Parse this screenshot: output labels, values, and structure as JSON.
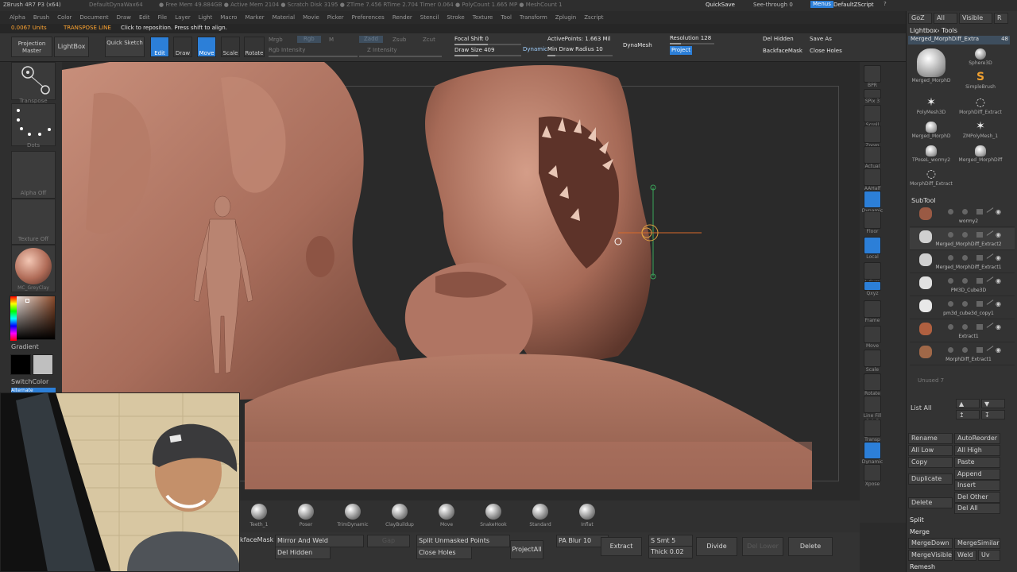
{
  "titlebar": {
    "app": "ZBrush 4R7 P3 (x64)",
    "doc": "DefaultDynaWax64",
    "stats": "● Free Mem 49.884GB ● Active Mem 2104 ● Scratch Disk 3195 ● ZTime 7.456 RTime 2.704 Timer 0.064 ● PolyCount 1.665 MP ● MeshCount 1",
    "quicksave": "QuickSave",
    "seethrough": "See-through",
    "seethrough_val": "0",
    "menus": "Menus",
    "script": "DefaultZScript"
  },
  "menubar": [
    "Alpha",
    "Brush",
    "Color",
    "Document",
    "Draw",
    "Edit",
    "File",
    "Layer",
    "Light",
    "Macro",
    "Marker",
    "Material",
    "Movie",
    "Picker",
    "Preferences",
    "Render",
    "Stencil",
    "Stroke",
    "Texture",
    "Tool",
    "Transform",
    "Zplugin",
    "Zscript"
  ],
  "notebar": {
    "units": "0.0067 Units",
    "mode": "TRANSPOSE LINE",
    "hint": "Click to reposition. Press shift to align."
  },
  "toolbar": {
    "projection_master": "Projection Master",
    "lightbox": "LightBox",
    "quick_sketch": "Quick Sketch",
    "edit": "Edit",
    "draw": "Draw",
    "move": "Move",
    "scale": "Scale",
    "rotate": "Rotate",
    "mrgb": "Mrgb",
    "rgb": "Rgb",
    "m": "M",
    "rgb_intensity": "Rgb Intensity",
    "zadd": "Zadd",
    "zsub": "Zsub",
    "zcut": "Zcut",
    "z_intensity": "Z Intensity",
    "focal_shift": "Focal Shift 0",
    "draw_size": "Draw Size 409",
    "dynamic": "Dynamic",
    "active_points": "ActivePoints: 1.663 Mil",
    "min_draw_radius": "Min Draw Radius 10",
    "dynamesh": "DynaMesh",
    "resolution": "Resolution 128",
    "project": "Project",
    "del_hidden": "Del Hidden",
    "save_as": "Save As",
    "backface_mask": "BackfaceMask",
    "close_holes": "Close Holes"
  },
  "leftshelf": {
    "transpose": "Transpose",
    "dots": "Dots",
    "alpha": "Alpha Off",
    "texture": "Texture Off",
    "material": "MC_GreyClay",
    "gradient": "Gradient",
    "switchcolor": "SwitchColor",
    "alternate": "Alternate"
  },
  "rightshelf": [
    {
      "id": "bpr",
      "label": "BPR"
    },
    {
      "id": "spix",
      "label": "SPix 3"
    },
    {
      "id": "scroll",
      "label": "Scroll"
    },
    {
      "id": "zoom",
      "label": "Zoom"
    },
    {
      "id": "actual",
      "label": "Actual"
    },
    {
      "id": "aahalf",
      "label": "AAHalf"
    },
    {
      "id": "persp",
      "label": "Dynamic Persp"
    },
    {
      "id": "floor",
      "label": "Floor"
    },
    {
      "id": "local",
      "label": "Local"
    },
    {
      "id": "lsym",
      "label": "L.Sym"
    },
    {
      "id": "xyz",
      "label": "Qxyz"
    },
    {
      "id": "frame",
      "label": "Frame"
    },
    {
      "id": "move",
      "label": "Move"
    },
    {
      "id": "scale",
      "label": "Scale"
    },
    {
      "id": "rotate",
      "label": "Rotate"
    },
    {
      "id": "linefill",
      "label": "Line Fill PolyF"
    },
    {
      "id": "transp",
      "label": "Transp"
    },
    {
      "id": "ghost",
      "label": "Dynamic Solo"
    },
    {
      "id": "xpose",
      "label": "Xpose"
    }
  ],
  "toolpanel": {
    "goz": "GoZ",
    "all": "All",
    "visible": "Visible",
    "r": "R",
    "title": "Lightbox› Tools",
    "current_tool": "Merged_MorphDiff_Extra",
    "current_tool_value": "48",
    "thumbnails": [
      {
        "name": "Merged_MorphD",
        "shape": "bust"
      },
      {
        "name": "Sphere3D",
        "shape": "sphere"
      },
      {
        "name": "SimpleBrush",
        "shape": "s"
      },
      {
        "name": "PolyMesh3D",
        "shape": "star"
      },
      {
        "name": "MorphDiff_Extract",
        "shape": "ring"
      },
      {
        "name": "Merged_MorphD",
        "shape": "bust"
      },
      {
        "name": "ZMPolyMesh_1",
        "shape": "star"
      },
      {
        "name": "TPoseL_wormy2",
        "shape": "bust"
      },
      {
        "name": "Merged_MorphDiff",
        "shape": "bust"
      },
      {
        "name": "MorphDiff_Extract",
        "shape": "ring"
      }
    ],
    "subtool_title": "SubTool",
    "subtools": [
      {
        "name": "wormy2",
        "sel": false
      },
      {
        "name": "Merged_MorphDiff_Extract2",
        "sel": true
      },
      {
        "name": "Merged_MorphDiff_Extract1",
        "sel": false
      },
      {
        "name": "PM3D_Cube3D",
        "sel": false
      },
      {
        "name": "pm3d_cube3d_copy1",
        "sel": false
      },
      {
        "name": "Extract1",
        "sel": false
      },
      {
        "name": "MorphDiff_Extract1",
        "sel": false
      }
    ],
    "unused": "Unused 7",
    "list_all": "List All",
    "rename": "Rename",
    "autoreorder": "AutoReorder",
    "all_low": "All Low",
    "all_high": "All High",
    "copy": "Copy",
    "paste": "Paste",
    "append": "Append",
    "duplicate": "Duplicate",
    "insert": "Insert",
    "delete": "Delete",
    "del_other": "Del Other",
    "del_all": "Del All",
    "split": "Split",
    "merge": "Merge",
    "mergedown": "MergeDown",
    "mergesimilar": "MergeSimilar",
    "mergevisible": "MergeVisible",
    "weld": "Weld",
    "uv": "Uv",
    "remesh": "Remesh"
  },
  "brushes": [
    {
      "label": "Teeth_1"
    },
    {
      "label": "Poser"
    },
    {
      "label": "TrimDynamic"
    },
    {
      "label": "ClayBuildup"
    },
    {
      "label": "Move"
    },
    {
      "label": "SnakeHook"
    },
    {
      "label": "Standard"
    },
    {
      "label": "Inflat"
    }
  ],
  "bottombar": {
    "backface_mask": "kfaceMask",
    "mirror_weld": "Mirror And Weld",
    "del_hidden": "Del Hidden",
    "gap": "Gap",
    "split_unmasked": "Split Unmasked Points",
    "close_holes": "Close Holes",
    "project_all": "ProjectAll",
    "pa_blur": "PA Blur 10",
    "extract": "Extract",
    "s_smt": "S Smt 5",
    "thick": "Thick 0.02",
    "divide": "Divide",
    "del_lower": "Del Lower",
    "delete": "Delete"
  },
  "colors": {
    "accent": "#2c7fd8",
    "highlight": "#ffa531",
    "clay": "#a5705e",
    "background": "#2a2a2a",
    "panel": "#333333"
  }
}
